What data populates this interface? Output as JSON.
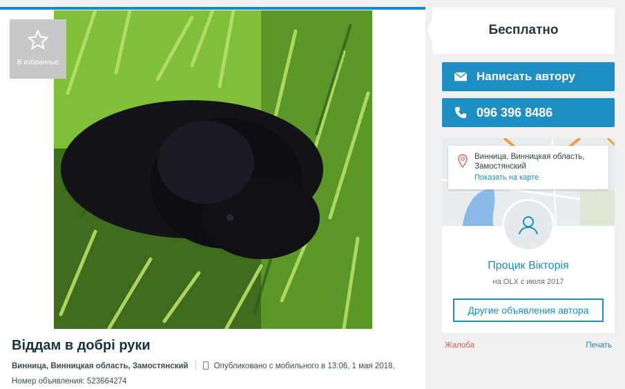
{
  "favorite": {
    "label": "В избранные"
  },
  "listing": {
    "title": "Віддам в добрі руки",
    "location": "Винница, Винницкая область, Замостянский",
    "published_prefix": "Опубликовано с мобильного",
    "published_time": "в 13:06, 1 мая 2018,",
    "id_label": "Номер объявления:",
    "id_value": "523664274"
  },
  "price": {
    "value": "Бесплатно"
  },
  "actions": {
    "write_label": "Написать автору",
    "phone_number": "096 396 8486"
  },
  "seller": {
    "address": "Винница, Винницкая область, Замостянский",
    "show_on_map": "Показать на карте",
    "name": "Процик Вікторія",
    "since": "на OLX с июля 2017",
    "other_ads_label": "Другие объявления автора"
  },
  "footer_links": {
    "complain": "Жалоба",
    "print": "Печать"
  },
  "colors": {
    "accent": "#1e8ec4",
    "link": "#1a8bbf",
    "complain": "#e25b45"
  }
}
